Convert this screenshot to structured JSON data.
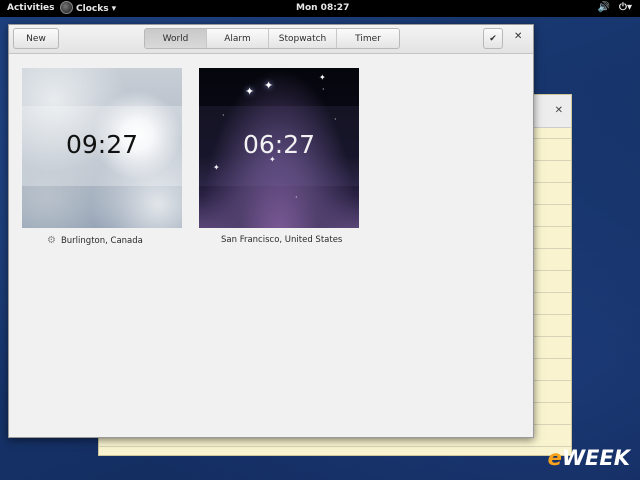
{
  "topbar": {
    "activities": "Activities",
    "app_menu": "Clocks",
    "app_menu_arrow": "▾",
    "clock": "Mon 08:27",
    "volume_icon": "🔊",
    "power_icon": "⏻",
    "power_arrow": "▾"
  },
  "window": {
    "new_button": "New",
    "tabs": [
      "World",
      "Alarm",
      "Stopwatch",
      "Timer"
    ],
    "active_tab": "World",
    "select_icon": "✔",
    "close_icon": "✕"
  },
  "background_window": {
    "close_icon": "✕"
  },
  "clocks": [
    {
      "time": "09:27",
      "location": "Burlington, Canada",
      "period": "day"
    },
    {
      "time": "06:27",
      "location": "San Francisco, United States",
      "period": "night"
    }
  ],
  "watermark": {
    "e": "e",
    "rest": "WEEK"
  }
}
